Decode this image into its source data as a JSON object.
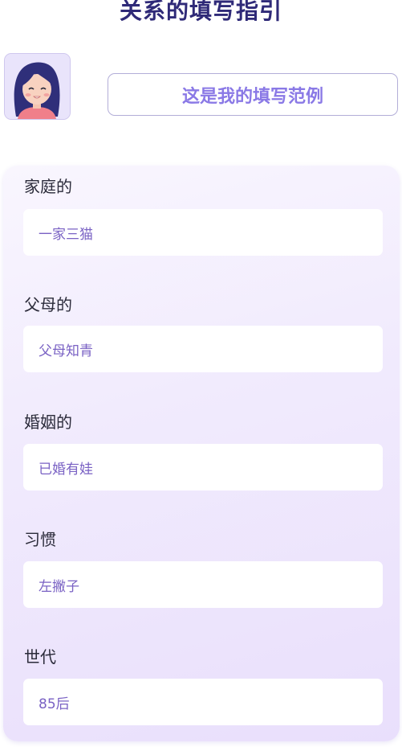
{
  "header": {
    "title": "关系的填写指引",
    "example_button_label": "这是我的填写范例"
  },
  "sections": [
    {
      "label": "家庭的",
      "value": "一家三猫"
    },
    {
      "label": "父母的",
      "value": "父母知青"
    },
    {
      "label": "婚姻的",
      "value": "已婚有娃"
    },
    {
      "label": "习惯",
      "value": "左撇子"
    },
    {
      "label": "世代",
      "value": "85后"
    }
  ]
}
